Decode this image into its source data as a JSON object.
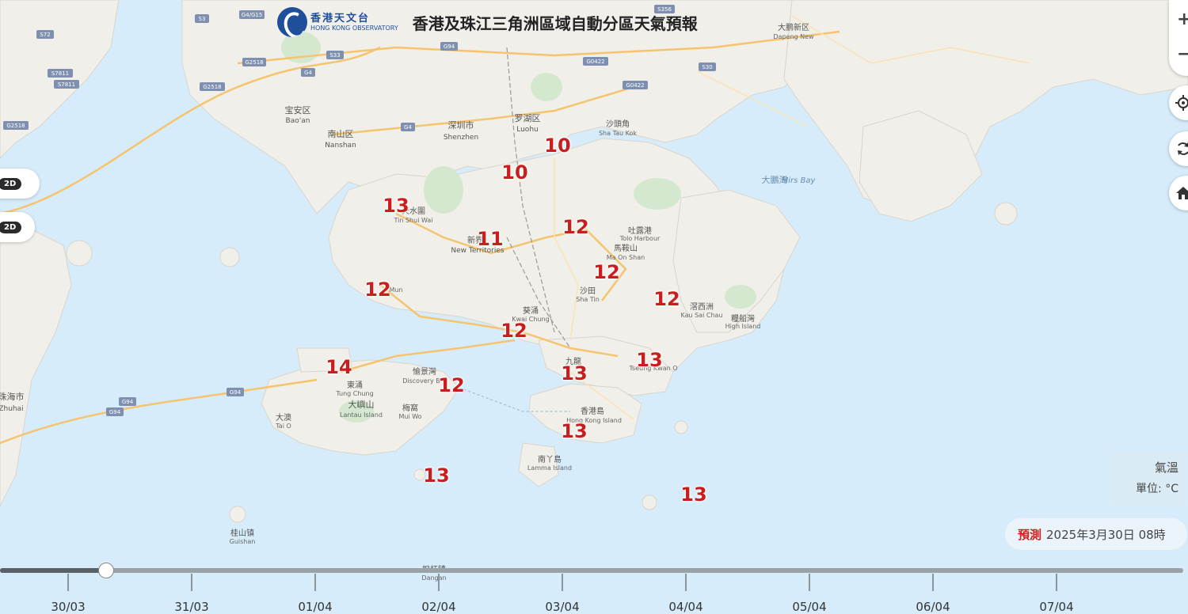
{
  "header": {
    "logo_zh": "香港天文台",
    "logo_en": "HONG KONG OBSERVATORY",
    "title": "香港及珠江三角洲區域自動分區天氣預報"
  },
  "controls": {
    "zoom_in": "+",
    "zoom_out": "−",
    "locate_icon": "crosshair-icon",
    "refresh_icon": "refresh-icon",
    "home_icon": "home-icon",
    "view_3d_label": "2D",
    "view_2d_label": "2D"
  },
  "legend": {
    "title": "氣溫",
    "unit": "單位: °C"
  },
  "forecast": {
    "label": "預測",
    "datetime": "2025年3月30日 08時"
  },
  "timeline": {
    "dates": [
      "30/03",
      "31/03",
      "01/04",
      "02/04",
      "03/04",
      "04/04",
      "05/04",
      "06/04",
      "07/04"
    ],
    "progress": 0.09
  },
  "temperatures": [
    {
      "value": "10"
    },
    {
      "value": "10"
    },
    {
      "value": "13"
    },
    {
      "value": "11"
    },
    {
      "value": "12"
    },
    {
      "value": "12"
    },
    {
      "value": "12"
    },
    {
      "value": "12"
    },
    {
      "value": "12"
    },
    {
      "value": "13"
    },
    {
      "value": "14"
    },
    {
      "value": "12"
    },
    {
      "value": "13"
    },
    {
      "value": "13"
    },
    {
      "value": "13"
    },
    {
      "value": "13"
    }
  ],
  "places": {
    "baoan_zh": "宝安区",
    "baoan_en": "Bao'an",
    "nanshan_zh": "南山区",
    "nanshan_en": "Nanshan",
    "shenzhen_zh": "深圳市",
    "shenzhen_en": "Shenzhen",
    "luohu_zh": "罗湖区",
    "luohu_en": "Luohu",
    "shataukok_zh": "沙頭角",
    "shataukok_en": "Sha Tau Kok",
    "dapeng_zh": "大鹏新区",
    "dapeng_en": "Dapeng New",
    "mirsbay_zh": "大鵬灣",
    "mirsbay_en": "Mirs Bay",
    "tinshuiwai_zh": "天水圍",
    "tinshuiwai_en": "Tin Shui Wai",
    "newterritories_zh": "新界",
    "newterritories_en": "New Territories",
    "tolo_zh": "吐露港",
    "tolo_en": "Tolo Harbour",
    "maonshan_zh": "馬鞍山",
    "maonshan_en": "Ma On Shan",
    "shatin_zh": "沙田",
    "shatin_en": "Sha Tin",
    "tuenmun_en": "Mun",
    "kwaichung_zh": "葵涌",
    "kwaichung_en": "Kwai Chung",
    "kausaichau_zh": "滘西洲",
    "kausaichau_en": "Kau Sai Chau",
    "highisland_zh": "糧船灣",
    "highisland_en": "High Island",
    "kowloon_zh": "九龍",
    "tseungkwano_en": "Tseung Kwan O",
    "tungchung_zh": "東涌",
    "tungchung_en": "Tung Chung",
    "discovery_zh": "愉景灣",
    "discovery_en": "Discovery B",
    "lantau_zh": "大嶼山",
    "lantau_en": "Lantau Island",
    "muiwo_zh": "梅窩",
    "muiwo_en": "Mui Wo",
    "taio_zh": "大澳",
    "taio_en": "Tai O",
    "hkisland_zh": "香港島",
    "hkisland_en": "Hong Kong Island",
    "lamma_zh": "南丫島",
    "lamma_en": "Lamma Island",
    "zhuhai_zh": "珠海市",
    "zhuhai_en": "Zhuhai",
    "guishan_zh": "桂山镇",
    "guishan_en": "Guishan",
    "dangan_zh": "担杆镇",
    "dangan_en": "Dangan"
  },
  "road_shields": [
    "S3",
    "G4/G15",
    "S72",
    "G2518",
    "S33",
    "G4",
    "S7811",
    "S7811",
    "G2518",
    "G2518",
    "G94",
    "G0422",
    "G0422",
    "S30",
    "G4",
    "S356",
    "G94",
    "G94",
    "G94"
  ],
  "colors": {
    "sea": "#d6ecfa",
    "land": "#f1efe9",
    "temperature": "#c81e1e",
    "forecast_label": "#d11f1f"
  }
}
